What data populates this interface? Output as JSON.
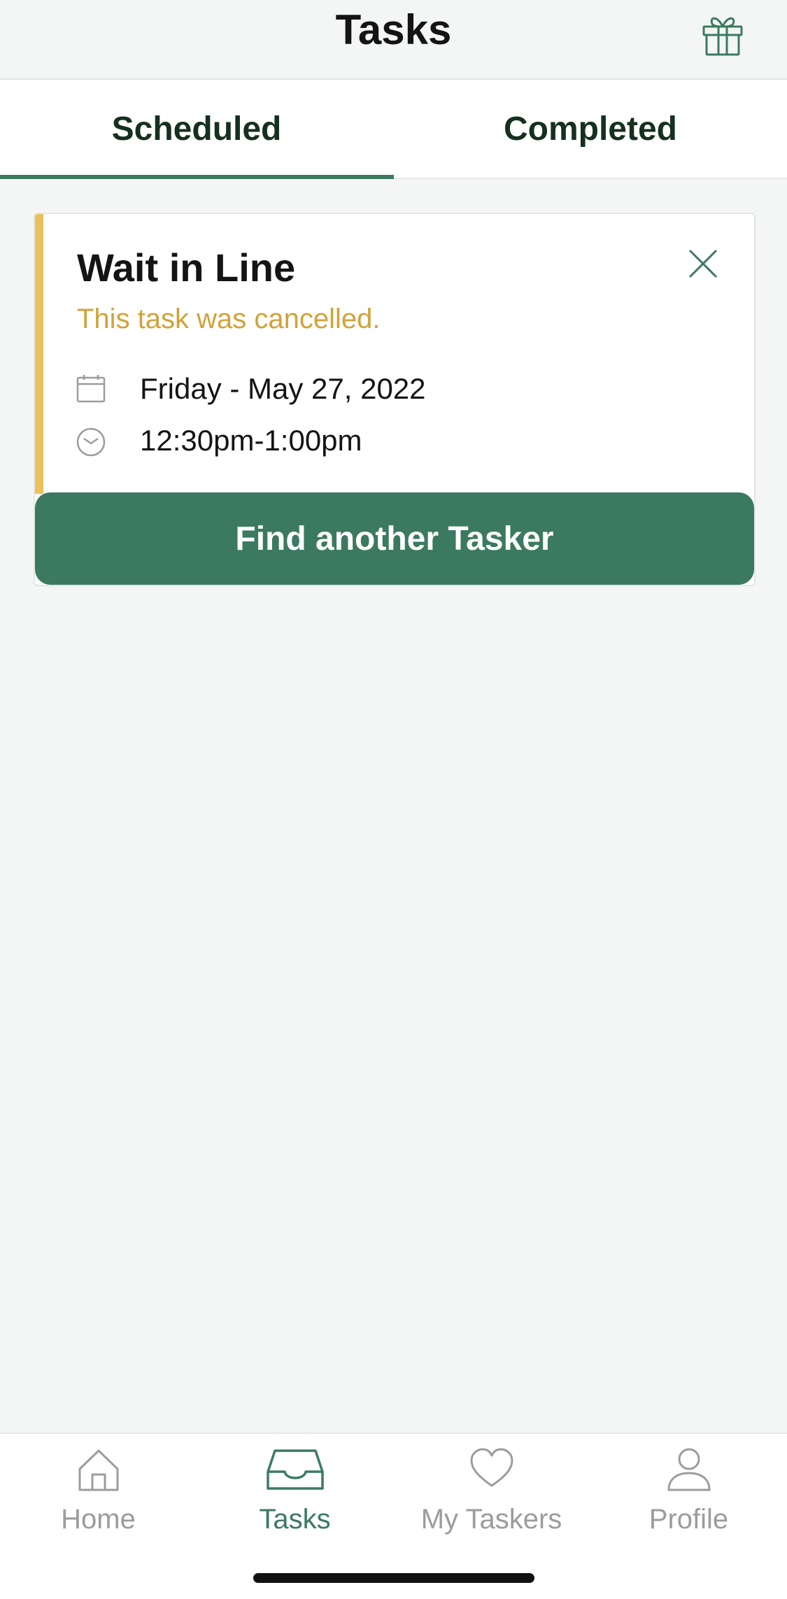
{
  "header": {
    "title": "Tasks",
    "gift_icon": "gift-icon"
  },
  "tabs": [
    {
      "label": "Scheduled",
      "active": true
    },
    {
      "label": "Completed",
      "active": false
    }
  ],
  "task_card": {
    "title": "Wait in Line",
    "status": "This task was cancelled.",
    "date": "Friday - May 27, 2022",
    "time": "12:30pm-1:00pm",
    "action_label": "Find another Tasker",
    "accent_color": "#ECC05A",
    "status_color": "#D2A239"
  },
  "bottom_nav": [
    {
      "label": "Home",
      "icon": "home-icon",
      "active": false
    },
    {
      "label": "Tasks",
      "icon": "inbox-icon",
      "active": true
    },
    {
      "label": "My Taskers",
      "icon": "heart-icon",
      "active": false
    },
    {
      "label": "Profile",
      "icon": "person-icon",
      "active": false
    }
  ],
  "colors": {
    "brand_green": "#3B7A60",
    "inactive_gray": "#9A9D9C"
  }
}
